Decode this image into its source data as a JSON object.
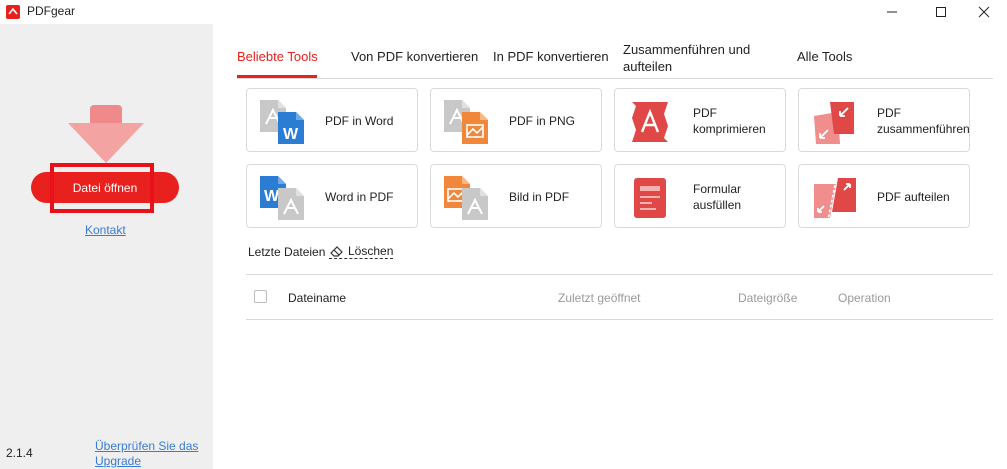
{
  "window": {
    "title": "PDFgear",
    "minimize_label": "—",
    "maximize_label": "☐",
    "close_label": "✕"
  },
  "sidebar": {
    "open_file_label": "Datei öffnen",
    "contact_label": "Kontakt",
    "version": "2.1.4",
    "upgrade_line1": "Überprüfen Sie das",
    "upgrade_line2": "Upgrade"
  },
  "tabs": [
    {
      "label": "Beliebte Tools"
    },
    {
      "label": "Von PDF konvertieren"
    },
    {
      "label": "In PDF konvertieren"
    },
    {
      "label_line1": "Zusammenführen und",
      "label_line2": "aufteilen"
    },
    {
      "label": "Alle Tools"
    }
  ],
  "tools": [
    {
      "line1": "PDF in Word",
      "line2": "",
      "icon": "pdf-to-word-icon"
    },
    {
      "line1": "PDF in PNG",
      "line2": "",
      "icon": "pdf-to-png-icon"
    },
    {
      "line1": "PDF",
      "line2": "komprimieren",
      "icon": "compress-pdf-icon"
    },
    {
      "line1": "PDF",
      "line2": "zusammenführen",
      "icon": "merge-pdf-icon"
    },
    {
      "line1": "Word in PDF",
      "line2": "",
      "icon": "word-to-pdf-icon"
    },
    {
      "line1": "Bild in PDF",
      "line2": "",
      "icon": "image-to-pdf-icon"
    },
    {
      "line1": "Formular",
      "line2": "ausfüllen",
      "icon": "fill-form-icon"
    },
    {
      "line1": "PDF aufteilen",
      "line2": "",
      "icon": "split-pdf-icon"
    }
  ],
  "recent": {
    "title": "Letzte Dateien",
    "clear_label": "Löschen",
    "columns": {
      "name": "Dateiname",
      "last_opened": "Zuletzt geöffnet",
      "size": "Dateigröße",
      "operation": "Operation"
    }
  },
  "colors": {
    "accent": "#e8211e",
    "link": "#3a7bd5",
    "word_blue": "#2b7cd3",
    "png_orange": "#f0873a",
    "pdf_red": "#e04848"
  }
}
